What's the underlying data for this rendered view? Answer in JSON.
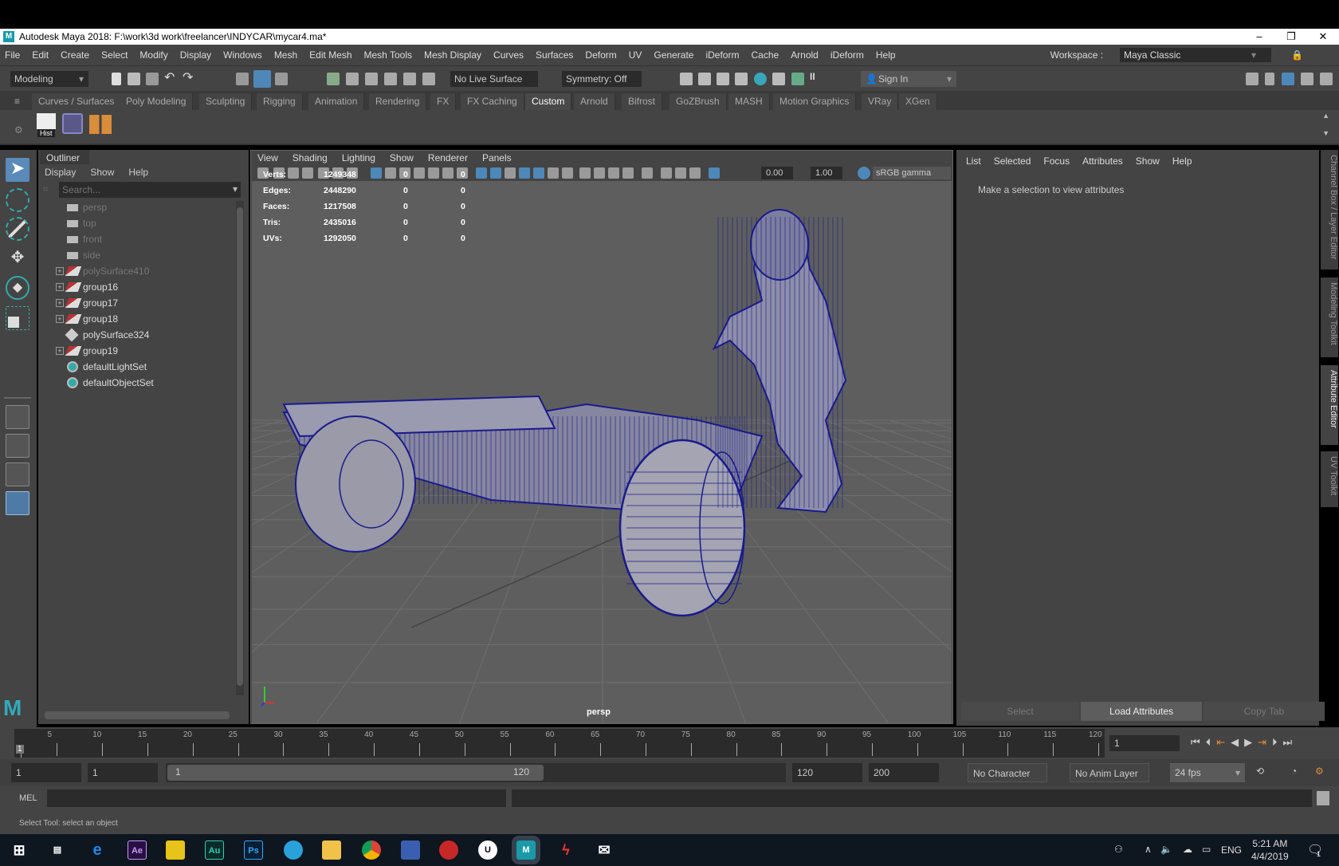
{
  "window": {
    "title": "Autodesk Maya 2018: F:\\work\\3d work\\freelancer\\INDYCAR\\mycar4.ma*",
    "minimize": "–",
    "maximize": "❐",
    "close": "✕"
  },
  "menu": [
    "File",
    "Edit",
    "Create",
    "Select",
    "Modify",
    "Display",
    "Windows",
    "Mesh",
    "Edit Mesh",
    "Mesh Tools",
    "Mesh Display",
    "Curves",
    "Surfaces",
    "Deform",
    "UV",
    "Generate",
    "iDeform",
    "Cache",
    "Arnold",
    "iDeform",
    "Help"
  ],
  "workspace": {
    "label": "Workspace :",
    "value": "Maya Classic"
  },
  "statusline": {
    "mode": "Modeling",
    "live_surface": "No Live Surface",
    "symmetry": "Symmetry: Off",
    "sign_in": "Sign In"
  },
  "shelf_tabs": [
    "Curves / Surfaces",
    "Poly Modeling",
    "Sculpting",
    "Rigging",
    "Animation",
    "Rendering",
    "FX",
    "FX Caching",
    "Custom",
    "Arnold",
    "Bifrost",
    "GoZBrush",
    "MASH",
    "Motion Graphics",
    "VRay",
    "XGen"
  ],
  "shelf_active": "Custom",
  "shelf": {
    "hist_label": "Hist"
  },
  "outliner": {
    "title": "Outliner",
    "menu": [
      "Display",
      "Show",
      "Help"
    ],
    "search_placeholder": "Search...",
    "items": [
      {
        "label": "persp",
        "icon": "camera-icon",
        "expandable": false,
        "dim": true
      },
      {
        "label": "top",
        "icon": "camera-icon",
        "expandable": false,
        "dim": true
      },
      {
        "label": "front",
        "icon": "camera-icon",
        "expandable": false,
        "dim": true
      },
      {
        "label": "side",
        "icon": "camera-icon",
        "expandable": false,
        "dim": true
      },
      {
        "label": "polySurface410",
        "icon": "group-icon",
        "expandable": true,
        "dim": true
      },
      {
        "label": "group16",
        "icon": "group-icon",
        "expandable": true,
        "dim": false
      },
      {
        "label": "group17",
        "icon": "group-icon",
        "expandable": true,
        "dim": false
      },
      {
        "label": "group18",
        "icon": "group-icon",
        "expandable": true,
        "dim": false
      },
      {
        "label": "polySurface324",
        "icon": "mesh-icon",
        "expandable": false,
        "dim": false
      },
      {
        "label": "group19",
        "icon": "group-icon",
        "expandable": true,
        "dim": false
      },
      {
        "label": "defaultLightSet",
        "icon": "set-icon",
        "expandable": false,
        "dim": false
      },
      {
        "label": "defaultObjectSet",
        "icon": "set-icon",
        "expandable": false,
        "dim": false
      }
    ]
  },
  "viewport": {
    "menu": [
      "View",
      "Shading",
      "Lighting",
      "Show",
      "Renderer",
      "Panels"
    ],
    "exposure": "0.00",
    "gamma": "1.00",
    "color_space": "sRGB gamma",
    "camera": "persp",
    "hud": [
      {
        "label": "Verts:",
        "v": "1249348",
        "a": "0",
        "b": "0"
      },
      {
        "label": "Edges:",
        "v": "2448290",
        "a": "0",
        "b": "0"
      },
      {
        "label": "Faces:",
        "v": "1217508",
        "a": "0",
        "b": "0"
      },
      {
        "label": "Tris:",
        "v": "2435016",
        "a": "0",
        "b": "0"
      },
      {
        "label": "UVs:",
        "v": "1292050",
        "a": "0",
        "b": "0"
      }
    ],
    "wire_color": "#1a1a8c"
  },
  "attr": {
    "menu": [
      "List",
      "Selected",
      "Focus",
      "Attributes",
      "Show",
      "Help"
    ],
    "message": "Make a selection to view attributes",
    "buttons": [
      "Select",
      "Load Attributes",
      "Copy Tab"
    ]
  },
  "side_tabs": [
    "Channel Box / Layer Editor",
    "Modeling Toolkit",
    "Attribute Editor",
    "UV Toolkit"
  ],
  "timeline": {
    "ticks": [
      "5",
      "10",
      "15",
      "20",
      "25",
      "30",
      "35",
      "40",
      "45",
      "50",
      "55",
      "60",
      "65",
      "70",
      "75",
      "80",
      "85",
      "90",
      "95",
      "100",
      "105",
      "110",
      "115",
      "120"
    ],
    "current": "1",
    "current_field": "1"
  },
  "range": {
    "start": "1",
    "playback_start": "1",
    "slider_start": "1",
    "slider_end": "120",
    "playback_end": "120",
    "end": "200",
    "character_set": "No Character Set",
    "anim_layer": "No Anim Layer",
    "fps": "24 fps"
  },
  "cmd": {
    "label": "MEL"
  },
  "help_line": "Select Tool: select an object",
  "taskbar": {
    "time": "5:21 AM",
    "date": "4/4/2019",
    "lang": "ENG",
    "apps": [
      "Ae",
      "Au",
      "Ps",
      "M"
    ],
    "notifications": "1"
  }
}
